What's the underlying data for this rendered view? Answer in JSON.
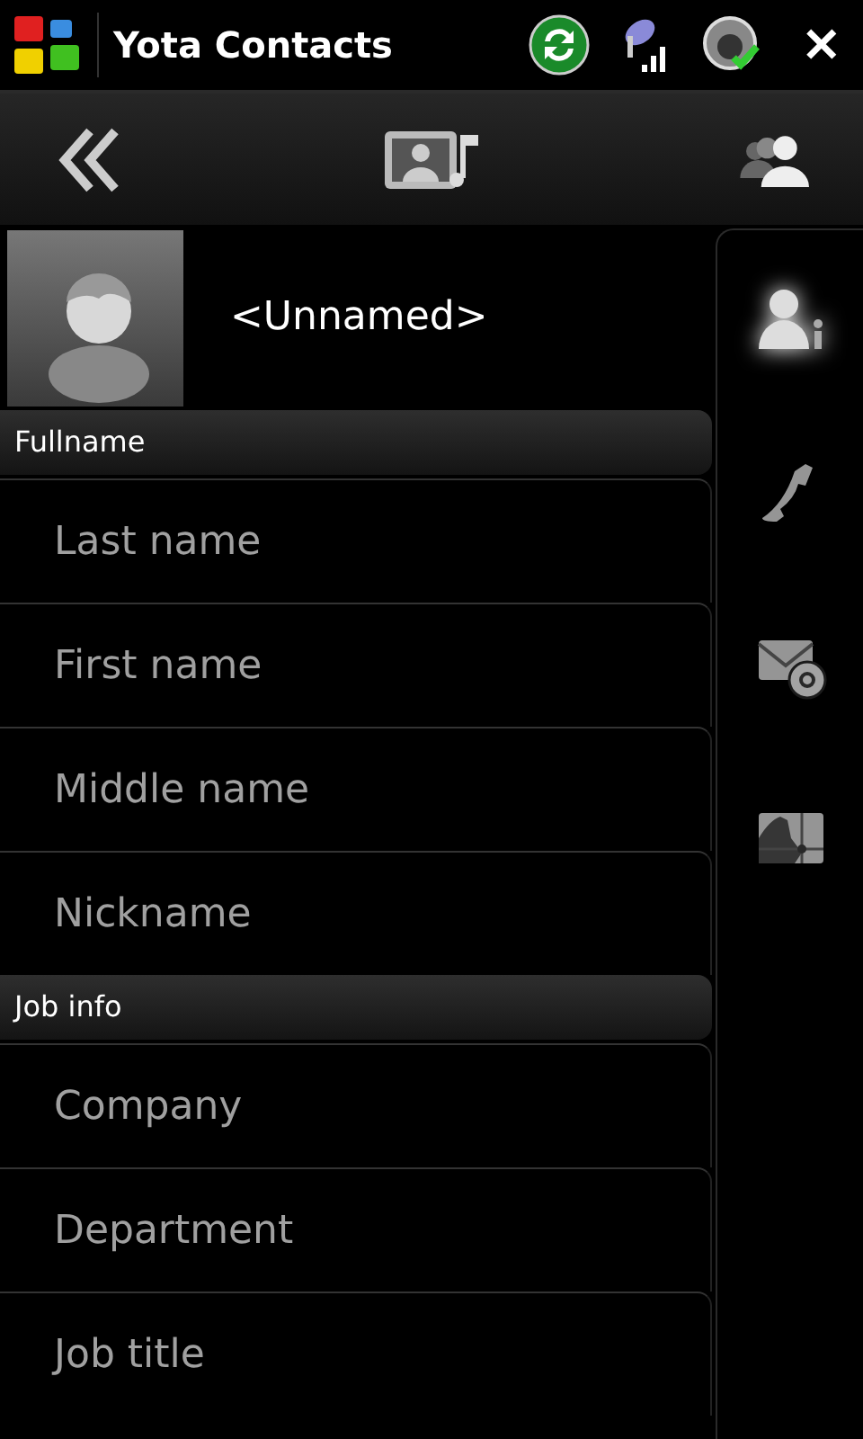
{
  "window": {
    "title": "Yota Contacts",
    "close": "✕"
  },
  "contact": {
    "name": "<Unnamed>"
  },
  "side_tabs": [
    {
      "kind": "info",
      "selected": true
    },
    {
      "kind": "phone",
      "selected": false
    },
    {
      "kind": "email",
      "selected": false
    },
    {
      "kind": "map",
      "selected": false
    }
  ],
  "sections": [
    {
      "title": "Fullname",
      "fields": [
        {
          "placeholder": "Last name"
        },
        {
          "placeholder": "First name"
        },
        {
          "placeholder": "Middle name"
        },
        {
          "placeholder": "Nickname"
        }
      ]
    },
    {
      "title": "Job info",
      "fields": [
        {
          "placeholder": "Company"
        },
        {
          "placeholder": "Department"
        },
        {
          "placeholder": "Job title"
        }
      ]
    }
  ]
}
